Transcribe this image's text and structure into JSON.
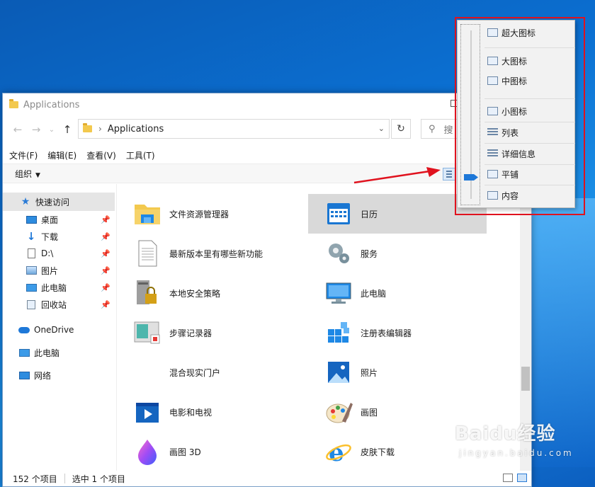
{
  "window": {
    "title": "Applications"
  },
  "address": {
    "path": "Applications",
    "search_placeholder": "搜"
  },
  "menubar": {
    "items": [
      "文件(F)",
      "编辑(E)",
      "查看(V)",
      "工具(T)"
    ]
  },
  "commandbar": {
    "organize": "组织"
  },
  "sidebar": {
    "quick_access": "快速访问",
    "items": [
      {
        "label": "桌面",
        "icon": "desktop-icon"
      },
      {
        "label": "下载",
        "icon": "download-icon"
      },
      {
        "label": "D:\\",
        "icon": "drive-icon"
      },
      {
        "label": "图片",
        "icon": "pictures-icon"
      },
      {
        "label": "此电脑",
        "icon": "computer-icon"
      },
      {
        "label": "回收站",
        "icon": "recycle-bin-icon"
      }
    ],
    "onedrive": "OneDrive",
    "this_pc": "此电脑",
    "network": "网络"
  },
  "tiles": [
    {
      "label": "文件资源管理器",
      "icon": "file-explorer-icon"
    },
    {
      "label": "日历",
      "icon": "calendar-icon"
    },
    {
      "label": "最新版本里有哪些新功能",
      "icon": "document-icon"
    },
    {
      "label": "服务",
      "icon": "services-gear-icon"
    },
    {
      "label": "本地安全策略",
      "icon": "security-policy-icon"
    },
    {
      "label": "此电脑",
      "icon": "computer-icon"
    },
    {
      "label": "步骤记录器",
      "icon": "steps-recorder-icon"
    },
    {
      "label": "注册表编辑器",
      "icon": "registry-editor-icon"
    },
    {
      "label": "混合现实门户",
      "icon": "mixed-reality-icon"
    },
    {
      "label": "照片",
      "icon": "photos-icon"
    },
    {
      "label": "电影和电视",
      "icon": "movies-tv-icon"
    },
    {
      "label": "画图",
      "icon": "paint-icon"
    },
    {
      "label": "画图 3D",
      "icon": "paint-3d-icon"
    },
    {
      "label": "皮肤下载",
      "icon": "internet-explorer-icon"
    }
  ],
  "status": {
    "count": "152 个项目",
    "selected": "选中 1 个项目"
  },
  "view_menu": {
    "items": [
      "超大图标",
      "大图标",
      "中图标",
      "小图标",
      "列表",
      "详细信息",
      "平铺",
      "内容"
    ],
    "selected": "平铺"
  },
  "watermark": {
    "logo": "Baidu经验",
    "url": "jingyan.baidu.com"
  },
  "colors": {
    "accent": "#1e78d8",
    "highlight_box": "#e0121e",
    "selected_tile": "#d9d9d9"
  }
}
